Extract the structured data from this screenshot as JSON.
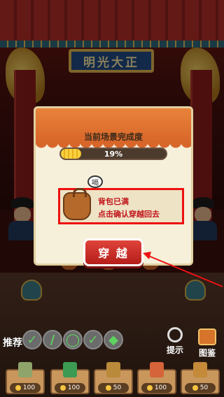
{
  "scene": {
    "plaque_text": "明光大正"
  },
  "popup": {
    "progress_title": "当前场景完成度",
    "progress_percent": 0.19,
    "progress_text": "19%",
    "speech_bubble": "嗝",
    "message_line1": "背包已满",
    "message_line2": "点击确认穿越回去",
    "cross_button": "穿 越"
  },
  "bottom_bar": {
    "recommend_label": "推荐",
    "hint_label": "提示",
    "album_label": "图鉴",
    "slot_icons": [
      "check-icon",
      "tool-icon",
      "ring-icon",
      "check-icon",
      "gem-icon"
    ],
    "shop_prices": [
      "100",
      "100",
      "50",
      "100",
      "50"
    ]
  },
  "colors": {
    "accent": "#d8662a",
    "button": "#c62a24",
    "highlight_border": "#ee1111"
  }
}
